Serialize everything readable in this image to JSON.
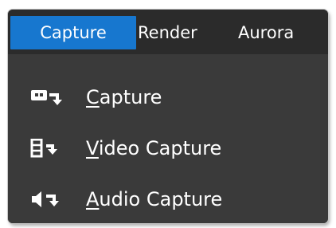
{
  "menubar": {
    "items": [
      {
        "label": "Capture",
        "active": true
      },
      {
        "label": "Render",
        "active": false
      },
      {
        "label": "Aurora",
        "active": false
      }
    ]
  },
  "dropdown": {
    "items": [
      {
        "mnemonic": "C",
        "rest": "apture",
        "icon": "capture-icon"
      },
      {
        "mnemonic": "V",
        "rest": "ideo Capture",
        "icon": "video-capture-icon"
      },
      {
        "mnemonic": "A",
        "rest": "udio Capture",
        "icon": "audio-capture-icon"
      }
    ]
  },
  "colors": {
    "menubar_bg": "#2b2b2b",
    "menu_bg": "#3a3a3a",
    "accent": "#1777cf",
    "text": "#ffffff"
  }
}
